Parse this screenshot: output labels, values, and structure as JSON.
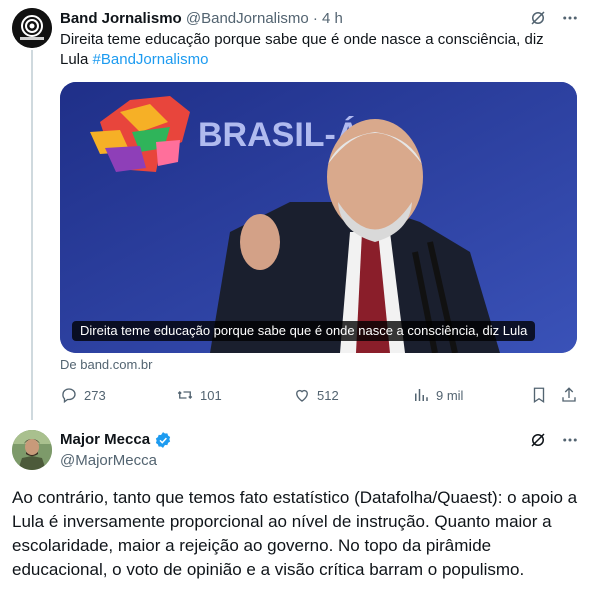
{
  "tweet1": {
    "display_name": "Band Jornalismo",
    "handle": "@BandJornalismo",
    "separator": "·",
    "time": "4 h",
    "text": "Direita teme educação porque sabe que é onde nasce a consciência, diz Lula",
    "hashtag": "#BandJornalismo",
    "card": {
      "caption": "Direita teme educação porque sabe que é onde nasce a consciência, diz Lula",
      "source": "De band.com.br",
      "banner_text": "BRASIL-ÁF"
    },
    "metrics": {
      "replies": "273",
      "reposts": "101",
      "likes": "512",
      "views": "9 mil"
    }
  },
  "tweet2": {
    "display_name": "Major Mecca",
    "handle": "@MajorMecca",
    "text": "Ao contrário, tanto que temos fato estatístico (Datafolha/Quaest): o apoio a Lula é inversamente proporcional ao nível de instrução. Quanto maior a escolaridade, maior a rejeição ao governo. No topo da pirâmide educacional, o voto de opinião e a visão crítica barram o populismo."
  },
  "colors": {
    "accent": "#1d9bf0",
    "muted": "#536471",
    "text": "#0f1419",
    "thread_line": "#cfd9de"
  }
}
